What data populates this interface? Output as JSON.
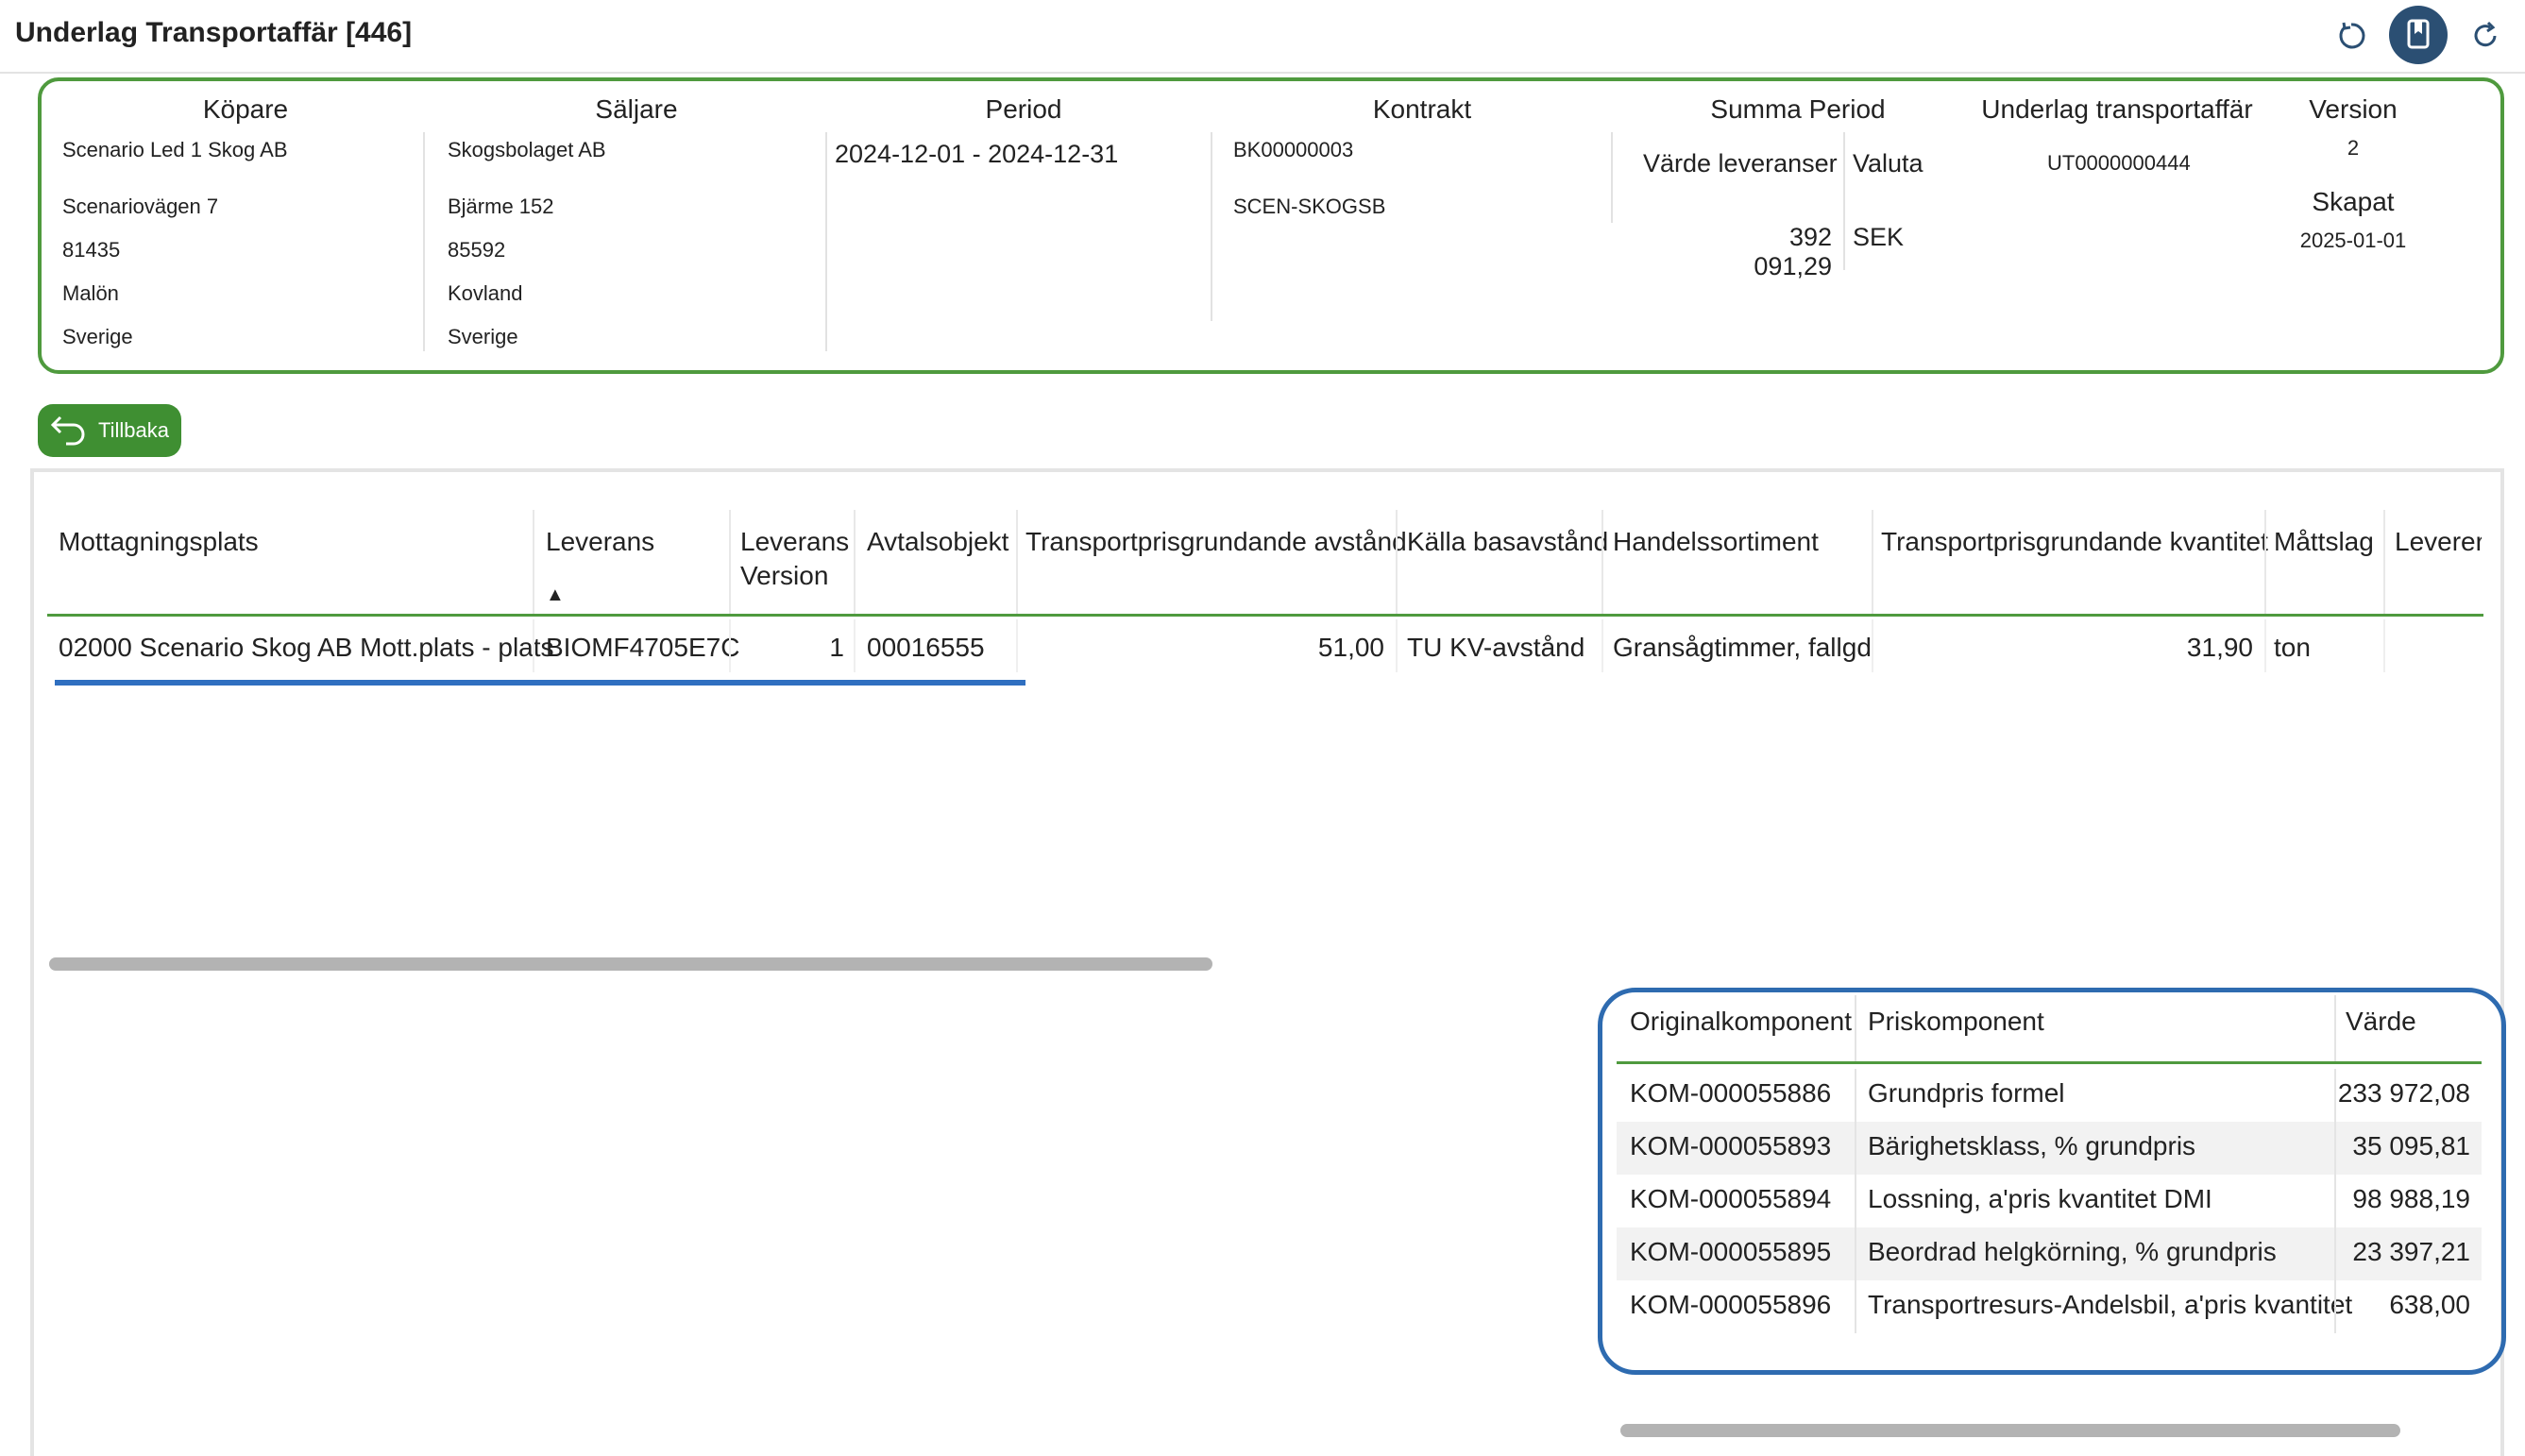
{
  "title": "Underlag Transportaffär [446]",
  "toolbar": {
    "icons": [
      "reset-icon",
      "bookmark-icon",
      "refresh-icon"
    ],
    "accent": "#2b4f73"
  },
  "summary": {
    "kopare": {
      "label": "Köpare",
      "name": "Scenario Led 1 Skog AB",
      "street": "Scenariovägen 7",
      "zip": "81435",
      "city": "Malön",
      "country": "Sverige"
    },
    "saljare": {
      "label": "Säljare",
      "name": "Skogsbolaget AB",
      "street": "Bjärme 152",
      "zip": "85592",
      "city": "Kovland",
      "country": "Sverige"
    },
    "period": {
      "label": "Period",
      "value": "2024-12-01 - 2024-12-31"
    },
    "kontrakt": {
      "label": "Kontrakt",
      "number": "BK00000003",
      "code": "SCEN-SKOGSB"
    },
    "summa": {
      "label": "Summa Period",
      "varde_label": "Värde leveranser",
      "valuta_label": "Valuta",
      "varde": "392 091,29",
      "valuta": "SEK"
    },
    "underlag": {
      "label": "Underlag transportaffär",
      "value": "UT0000000444"
    },
    "version": {
      "label": "Version",
      "value": "2",
      "skapat_label": "Skapat",
      "skapat": "2025-01-01"
    },
    "border_color": "#4f9a3e"
  },
  "back_button": {
    "label": "Tillbaka"
  },
  "main_table": {
    "headers": {
      "mottagningsplats": "Mottagningsplats",
      "leverans": "Leverans",
      "leverans_version": "Leverans Version",
      "avtalsobjekt": "Avtalsobjekt",
      "avstand": "Transportprisgrundande avstånd",
      "kalla": "Källa basavstånd",
      "handelssortiment": "Handelssortiment",
      "kvantitet": "Transportprisgrundande kvantitet",
      "mattslag": "Måttslag",
      "levererad": "Leverera"
    },
    "sort_indicator": "▲",
    "rows": [
      {
        "mottagningsplats": "02000 Scenario Skog AB Mott.plats - plats",
        "leverans": "BIOMF4705E7C",
        "leverans_version": "1",
        "avtalsobjekt": "00016555",
        "avstand": "51,00",
        "kalla": "TU KV-avstånd",
        "handelssortiment": "Gransågtimmer, fallgd",
        "kvantitet": "31,90",
        "mattslag": "ton"
      }
    ]
  },
  "price_components": {
    "headers": {
      "original": "Originalkomponent",
      "pris": "Priskomponent",
      "varde": "Värde"
    },
    "rows": [
      {
        "original": "KOM-000055886",
        "pris": "Grundpris formel",
        "varde": "233 972,08"
      },
      {
        "original": "KOM-000055893",
        "pris": "Bärighetsklass, % grundpris",
        "varde": "35 095,81"
      },
      {
        "original": "KOM-000055894",
        "pris": "Lossning, a'pris kvantitet DMI",
        "varde": "98 988,19"
      },
      {
        "original": "KOM-000055895",
        "pris": "Beordrad helgkörning, % grundpris",
        "varde": "23 397,21"
      },
      {
        "original": "KOM-000055896",
        "pris": "Transportresurs-Andelsbil, a'pris kvantitet",
        "varde": "638,00"
      }
    ],
    "border_color": "#2e6bb0"
  }
}
